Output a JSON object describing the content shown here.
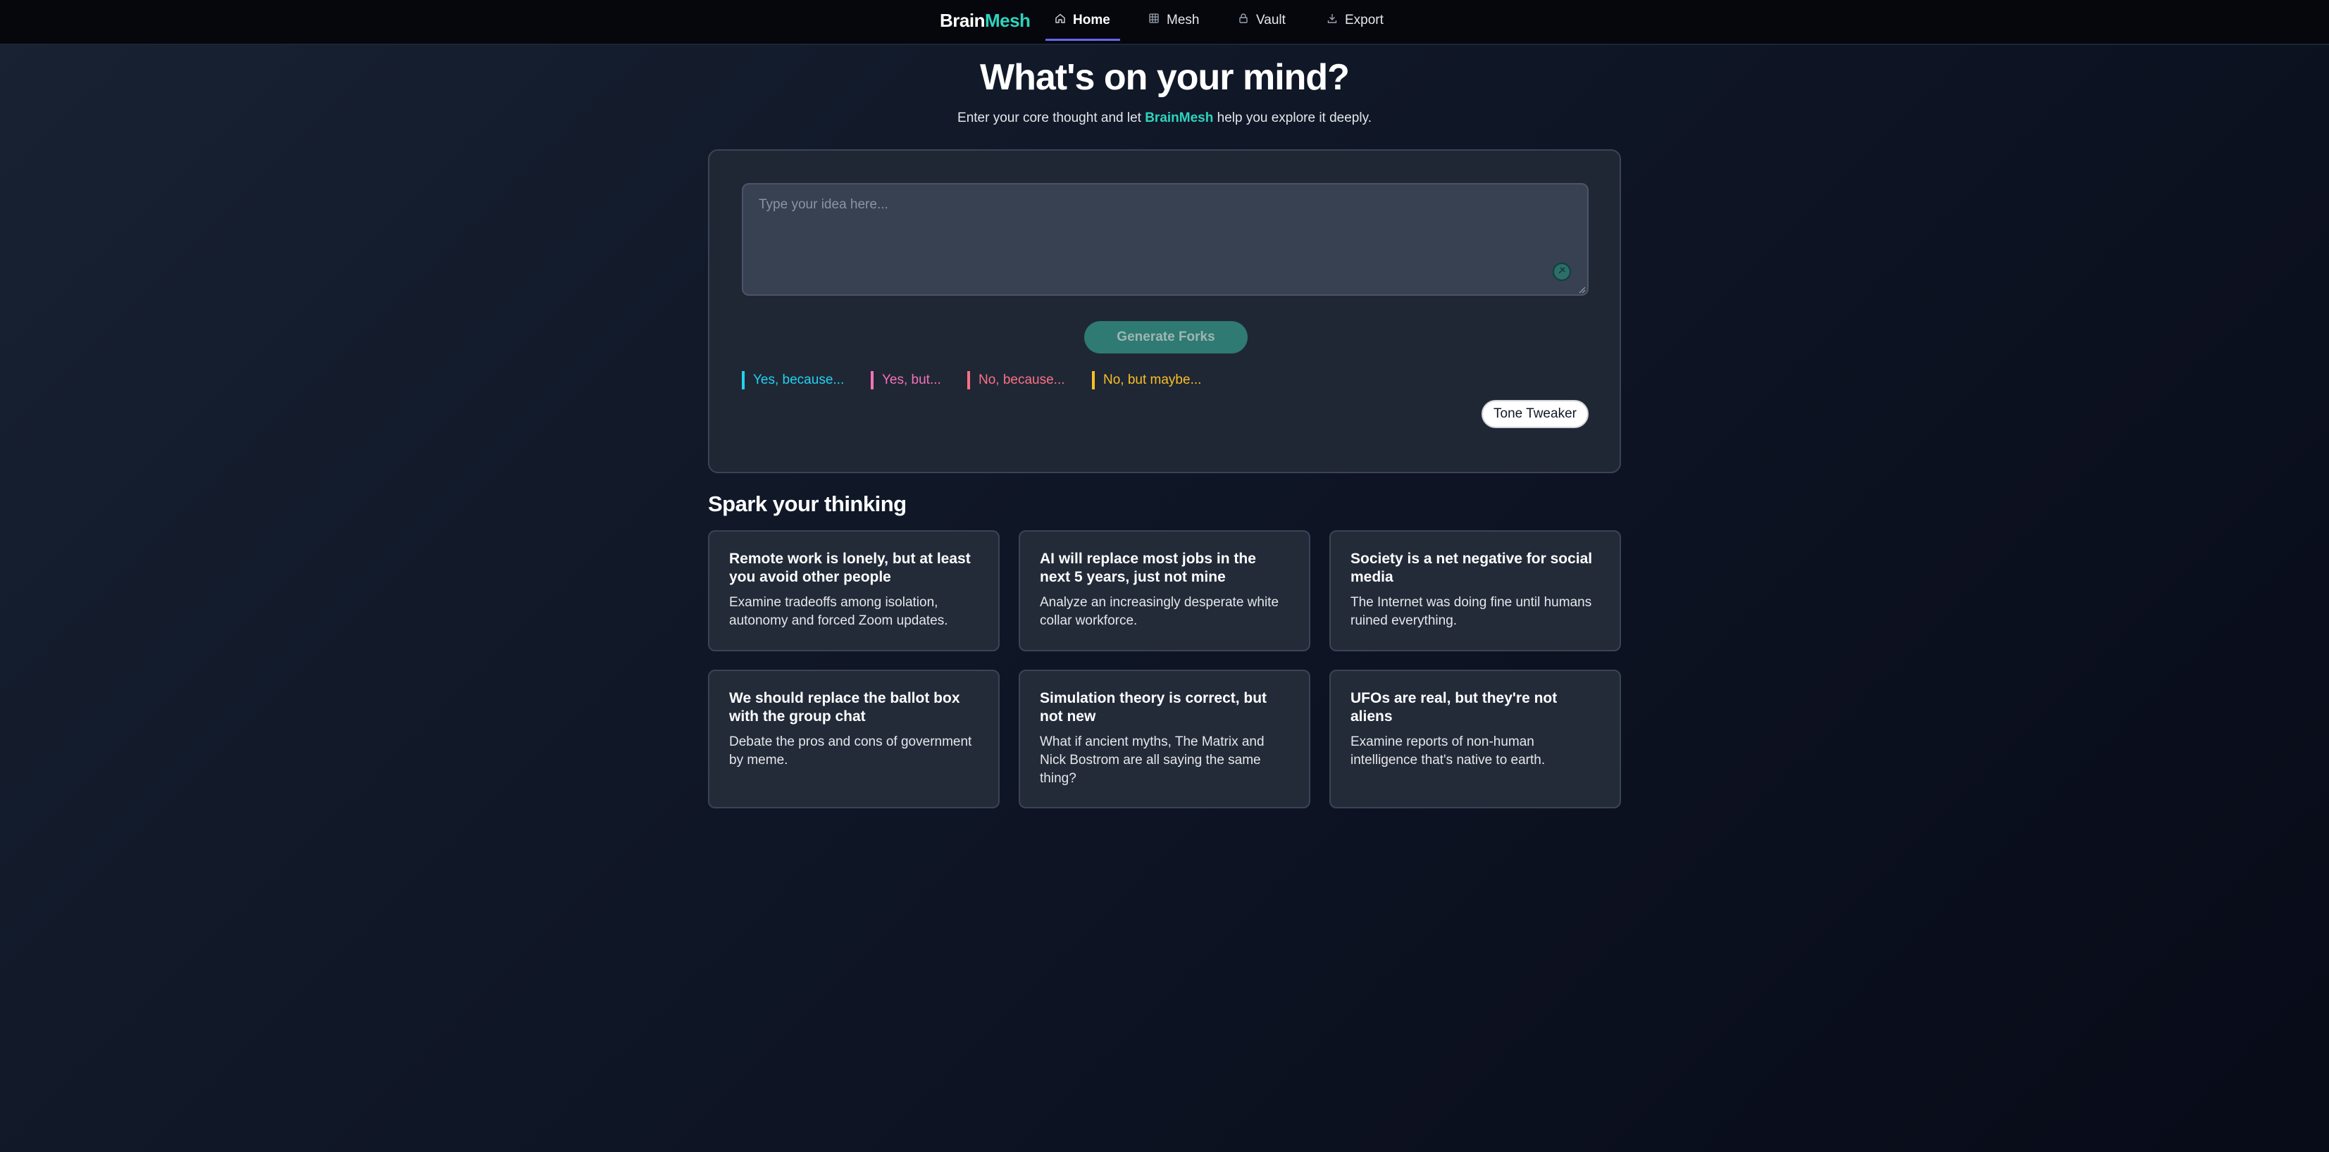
{
  "nav": {
    "brand_part1": "Brain",
    "brand_part2": "Mesh",
    "items": [
      {
        "label": "Home",
        "icon": "home-icon",
        "active": true
      },
      {
        "label": "Mesh",
        "icon": "grid-icon",
        "active": false
      },
      {
        "label": "Vault",
        "icon": "lock-icon",
        "active": false
      },
      {
        "label": "Export",
        "icon": "download-icon",
        "active": false
      }
    ]
  },
  "hero": {
    "title": "What's on your mind?",
    "subtitle_before": "Enter your core thought and let ",
    "subtitle_brand": "BrainMesh",
    "subtitle_after": " help you explore it deeply."
  },
  "composer": {
    "placeholder": "Type your idea here...",
    "mic_icon": "microphone-icon",
    "generate_label": "Generate Forks",
    "forks": [
      {
        "label": "Yes, because...",
        "color": "#22d3ee"
      },
      {
        "label": "Yes, but...",
        "color": "#f472b6"
      },
      {
        "label": "No, because...",
        "color": "#fb7185"
      },
      {
        "label": "No, but maybe...",
        "color": "#fbbf24"
      }
    ],
    "tone_label": "Tone Tweaker"
  },
  "spark": {
    "title": "Spark your thinking",
    "cards": [
      {
        "title": "Remote work is lonely, but at least you avoid other people",
        "desc": "Examine tradeoffs among isolation, autonomy and forced Zoom updates."
      },
      {
        "title": "AI will replace most jobs in the next 5 years, just not mine",
        "desc": "Analyze an increasingly desperate white collar workforce."
      },
      {
        "title": "Society is a net negative for social media",
        "desc": "The Internet was doing fine until humans ruined everything."
      },
      {
        "title": "We should replace the ballot box with the group chat",
        "desc": "Debate the pros and cons of government by meme."
      },
      {
        "title": "Simulation theory is correct, but not new",
        "desc": "What if ancient myths, The Matrix and Nick Bostrom are all saying the same thing?"
      },
      {
        "title": "UFOs are real, but they're not aliens",
        "desc": "Examine reports of non-human intelligence that's native to earth."
      }
    ]
  },
  "colors": {
    "accent": "#2dd4bf",
    "nav_underline": "#6366f1",
    "generate_button": "#2f7a73"
  }
}
